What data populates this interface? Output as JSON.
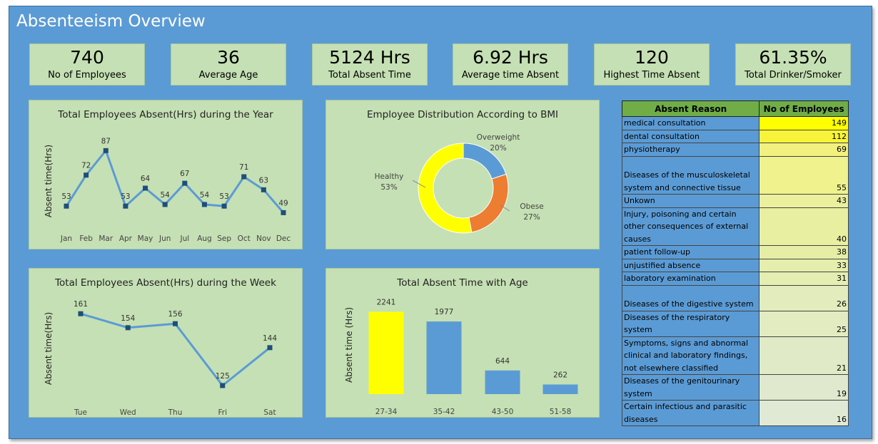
{
  "title": "Absenteeism Overview",
  "kpis": [
    {
      "value": "740",
      "label": "No of Employees"
    },
    {
      "value": "36",
      "label": "Average Age"
    },
    {
      "value": "5124 Hrs",
      "label": "Total Absent Time"
    },
    {
      "value": "6.92 Hrs",
      "label": "Average time Absent"
    },
    {
      "value": "120",
      "label": "Highest Time Absent"
    },
    {
      "value": "61.35%",
      "label": "Total Drinker/Smoker"
    }
  ],
  "colors": {
    "background": "#5b9bd5",
    "panel": "#c5e0b4",
    "line": "#5b9bd5",
    "highlight": "#ffff00",
    "orange": "#ed7d31"
  },
  "chart_data": [
    {
      "type": "line",
      "title": "Total Employees Absent(Hrs) during the Year",
      "ylabel": "Absent time(Hrs)",
      "categories": [
        "Jan",
        "Feb",
        "Mar",
        "Apr",
        "May",
        "Jun",
        "Jul",
        "Aug",
        "Sep",
        "Oct",
        "Nov",
        "Dec"
      ],
      "values": [
        53,
        72,
        87,
        53,
        64,
        54,
        67,
        54,
        53,
        71,
        63,
        49
      ],
      "ylim": [
        40,
        95
      ]
    },
    {
      "type": "pie",
      "title": "Employee Distribution According to BMI",
      "slices": [
        {
          "name": "Overweight",
          "pct": "20%",
          "value": 20,
          "color": "#5b9bd5"
        },
        {
          "name": "Obese",
          "pct": "27%",
          "value": 27,
          "color": "#ed7d31"
        },
        {
          "name": "Healthy",
          "pct": "53%",
          "value": 53,
          "color": "#ffff00"
        }
      ]
    },
    {
      "type": "line",
      "title": "Total Employees Absent(Hrs) during the Week",
      "ylabel": "Absent time(Hrs)",
      "categories": [
        "Tue",
        "Wed",
        "Thu",
        "Fri",
        "Sat"
      ],
      "values": [
        161,
        154,
        156,
        125,
        144
      ],
      "ylim": [
        120,
        165
      ]
    },
    {
      "type": "bar",
      "title": "Total Absent Time with Age",
      "ylabel": "Absent time (Hrs)",
      "categories": [
        "27-34",
        "35-42",
        "43-50",
        "51-58"
      ],
      "values": [
        2241,
        1977,
        644,
        262
      ],
      "colors": [
        "#ffff00",
        "#5b9bd5",
        "#5b9bd5",
        "#5b9bd5"
      ],
      "ylim": [
        0,
        2600
      ]
    }
  ],
  "table": {
    "headers": [
      "Absent Reason",
      "No of Employees"
    ],
    "rows": [
      {
        "lines": [
          "medical consultation"
        ],
        "count": "149",
        "bg": "#ffff00"
      },
      {
        "lines": [
          "dental consultation"
        ],
        "count": "112",
        "bg": "#f7f33a"
      },
      {
        "lines": [
          "physiotherapy"
        ],
        "count": "69",
        "bg": "#f2f07e"
      },
      {
        "lines": [
          "",
          "Diseases of the musculoskeletal",
          "system and connective tissue"
        ],
        "count": "55",
        "bg": "#eff28d"
      },
      {
        "lines": [
          "Unkown"
        ],
        "count": "43",
        "bg": "#eaf09c"
      },
      {
        "lines": [
          "Injury, poisoning and certain",
          "other consequences of external",
          "causes"
        ],
        "count": "40",
        "bg": "#e8efa0"
      },
      {
        "lines": [
          "patient follow-up"
        ],
        "count": "38",
        "bg": "#e6eea6"
      },
      {
        "lines": [
          "unjustified absence"
        ],
        "count": "33",
        "bg": "#e5eeac"
      },
      {
        "lines": [
          "laboratory examination"
        ],
        "count": "31",
        "bg": "#e4edb2"
      },
      {
        "lines": [
          "",
          "Diseases of the digestive system"
        ],
        "count": "26",
        "bg": "#e3ecbc"
      },
      {
        "lines": [
          "Diseases of the respiratory",
          "system"
        ],
        "count": "25",
        "bg": "#e2ecc0"
      },
      {
        "lines": [
          "Symptoms, signs and abnormal",
          "clinical and laboratory findings,",
          "not elsewhere classified"
        ],
        "count": "21",
        "bg": "#e1eac6"
      },
      {
        "lines": [
          "Diseases of the genitourinary",
          "system"
        ],
        "count": "19",
        "bg": "#e0e9ce"
      },
      {
        "lines": [
          "Certain infectious and parasitic",
          "diseases"
        ],
        "count": "16",
        "bg": "#dfe9d4"
      }
    ]
  }
}
